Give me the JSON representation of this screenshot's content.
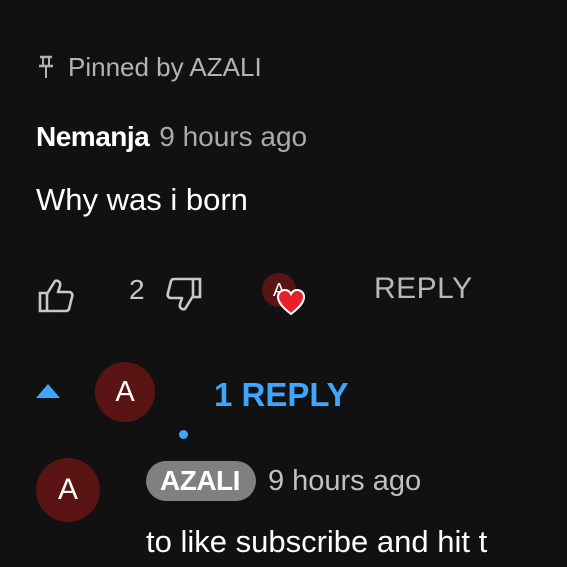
{
  "pinned": {
    "label": "Pinned by AZALI",
    "icon": "pin-icon"
  },
  "comment": {
    "author": "Nemanja",
    "time": "9 hours ago",
    "text": "Why was i born",
    "likes": "2",
    "reply_label": "REPLY"
  },
  "creator": {
    "initial": "A"
  },
  "replies": {
    "toggle_label": "1 REPLY",
    "avatar_initial": "A"
  },
  "reply": {
    "avatar_initial": "A",
    "author": "AZALI",
    "time": "9 hours ago",
    "text": "to like subscribe and hit t"
  },
  "colors": {
    "background": "#111111",
    "accent_blue": "#3ea6ff",
    "heart_red": "#e8202a",
    "avatar_maroon": "#5a1414",
    "chip_gray": "#808080"
  }
}
